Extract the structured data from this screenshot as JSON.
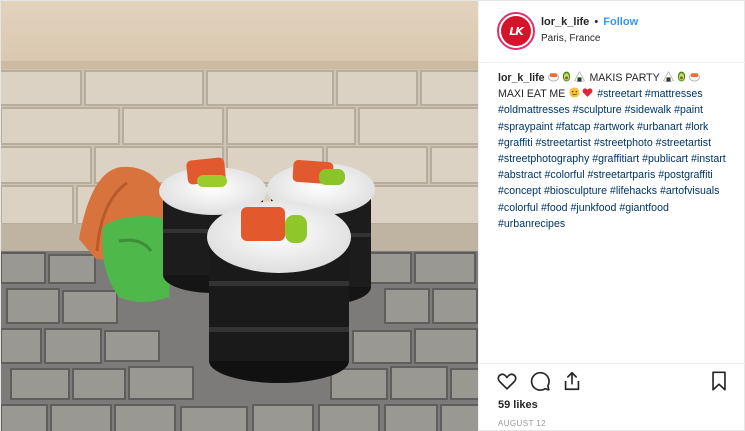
{
  "post": {
    "username": "lor_k_life",
    "separator": "•",
    "follow_label": "Follow",
    "location": "Paris, France"
  },
  "caption": {
    "username": "lor_k_life",
    "line1_text": "MAKIS PARTY",
    "line2_text": "MAXI EAT ME",
    "hashtags": [
      "#streetart",
      "#mattresses",
      "#oldmattresses",
      "#sculpture",
      "#sidewalk",
      "#paint",
      "#spraypaint",
      "#fatcap",
      "#artwork",
      "#urbanart",
      "#lork",
      "#graffiti",
      "#streetartist",
      "#streetphoto",
      "#streetartist",
      "#streetphotography",
      "#graffitiart",
      "#publicart",
      "#instart",
      "#abstract",
      "#colorful",
      "#streetartparis",
      "#postgraffiti",
      "#concept",
      "#biosculpture",
      "#lifehacks",
      "#artofvisuals",
      "#colorful",
      "#food",
      "#junkfood",
      "#giantfood",
      "#urbanrecipes"
    ],
    "emoji_before": [
      "sushi-emoji",
      "avocado-emoji",
      "onigiri-emoji"
    ],
    "emoji_after": [
      "onigiri-emoji",
      "avocado-emoji",
      "sushi-emoji"
    ],
    "emoji_line2": [
      "face-emoji",
      "red-heart-emoji"
    ]
  },
  "actions": {
    "icons": [
      "heart-icon",
      "comment-icon",
      "share-icon",
      "bookmark-icon"
    ]
  },
  "likes": "59 likes",
  "date": "AUGUST 12",
  "colors": {
    "follow": "#3897f0",
    "hashtag": "#003569",
    "avatar": "#d3142a",
    "date": "#999999"
  }
}
